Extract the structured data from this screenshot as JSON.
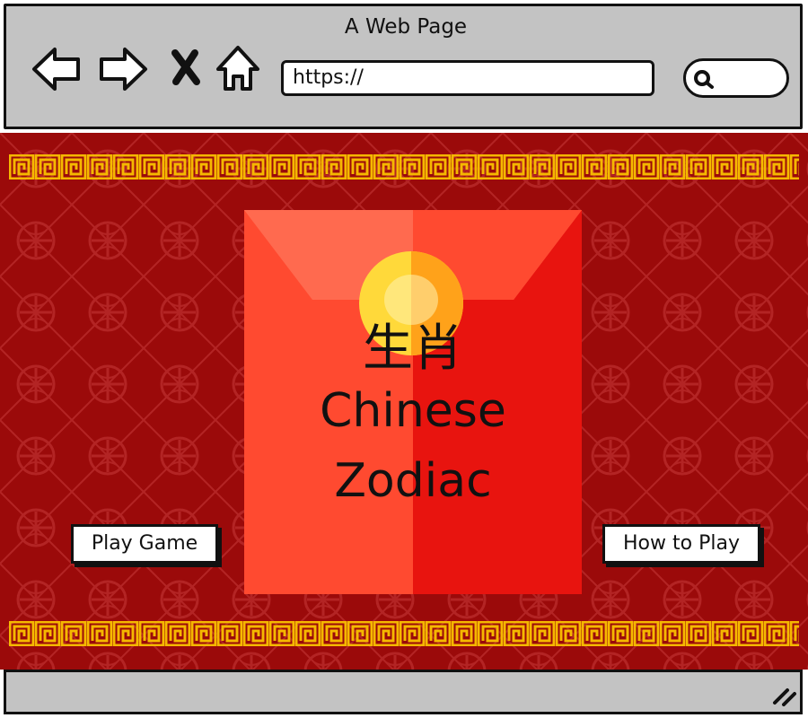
{
  "window": {
    "title": "A Web Page"
  },
  "toolbar": {
    "back_icon": "back-arrow-icon",
    "forward_icon": "forward-arrow-icon",
    "close_icon": "close-x-icon",
    "home_icon": "home-icon",
    "url": "https://",
    "search_icon": "search-icon"
  },
  "hero": {
    "title_cn": "生肖",
    "title_en_line1": "Chinese",
    "title_en_line2": "Zodiac"
  },
  "buttons": {
    "play": "Play Game",
    "how_to": "How to Play"
  },
  "colors": {
    "background_red": "#9b0a0a",
    "border_gold": "#f5b800",
    "envelope_left": "#ff4a30",
    "envelope_right": "#e8140f",
    "flap": "#ff6a4f",
    "coin": "#ffd93a",
    "chrome_gray": "#c3c3c3"
  }
}
